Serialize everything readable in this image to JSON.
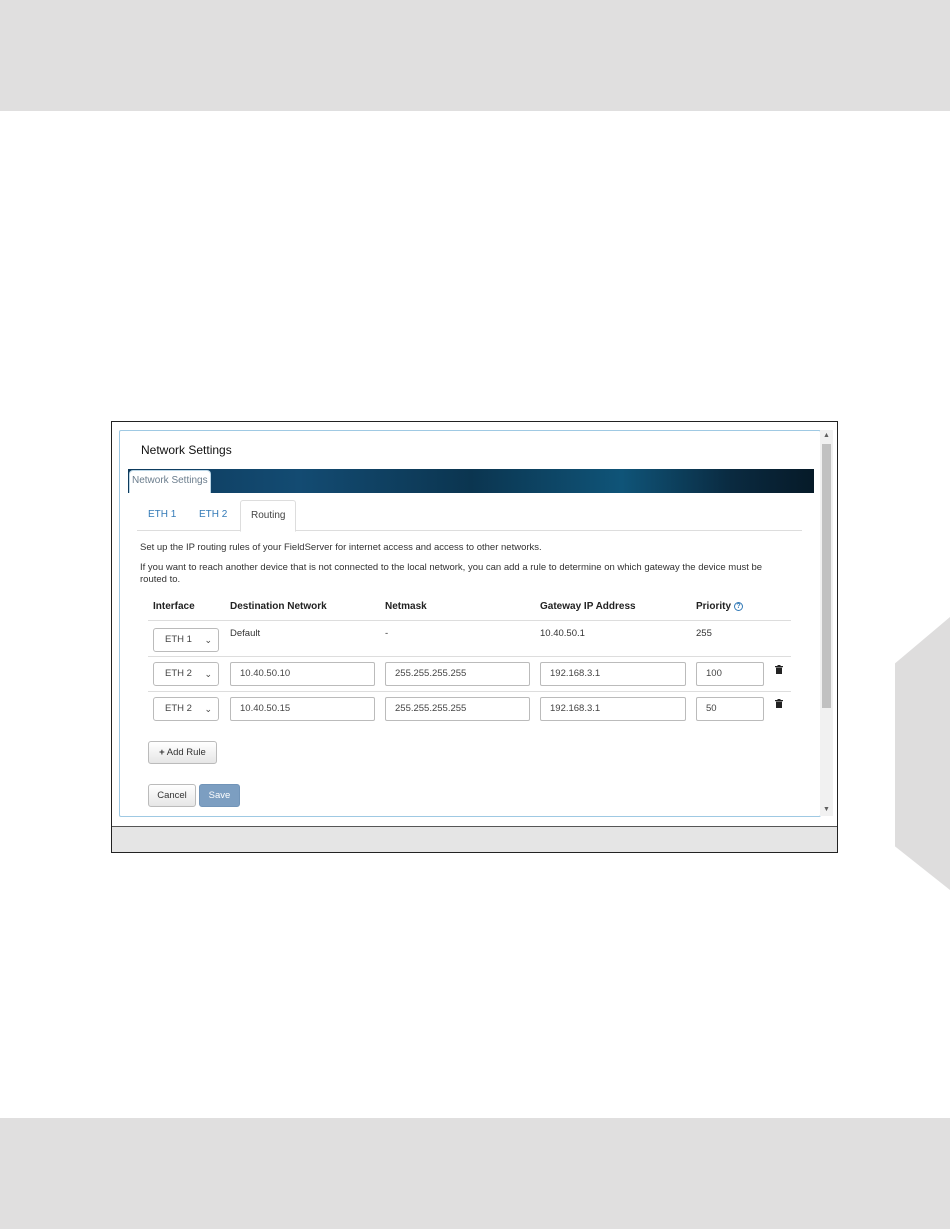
{
  "app_title": "Network Settings",
  "banner_tab_label": "Network Settings",
  "tabs": [
    {
      "label": "ETH 1"
    },
    {
      "label": "ETH 2"
    },
    {
      "label": "Routing"
    }
  ],
  "description": {
    "line1": "Set up the IP routing rules of your FieldServer for internet access and access to other networks.",
    "line2": "If you want to reach another device that is not connected to the local network, you can add a rule to determine on which gateway the device must be routed to."
  },
  "table": {
    "headers": [
      "Interface",
      "Destination Network",
      "Netmask",
      "Gateway IP Address",
      "Priority"
    ],
    "rows": [
      {
        "interface": "ETH 1",
        "destination": "Default",
        "netmask": "-",
        "gateway": "10.40.50.1",
        "priority": "255"
      },
      {
        "interface": "ETH 2",
        "destination": "10.40.50.10",
        "netmask": "255.255.255.255",
        "gateway": "192.168.3.1",
        "priority": "100"
      },
      {
        "interface": "ETH 2",
        "destination": "10.40.50.15",
        "netmask": "255.255.255.255",
        "gateway": "192.168.3.1",
        "priority": "50"
      }
    ]
  },
  "buttons": {
    "add_rule": "Add Rule",
    "cancel": "Cancel",
    "save": "Save"
  },
  "icons": {
    "help": "question-circle-icon",
    "delete": "trash-icon",
    "add": "plus-icon",
    "dropdown": "chevron-down-icon"
  },
  "colors": {
    "accent": "#337ab7",
    "save_button": "#7c9ec1",
    "banner": "#0d3a5c"
  }
}
